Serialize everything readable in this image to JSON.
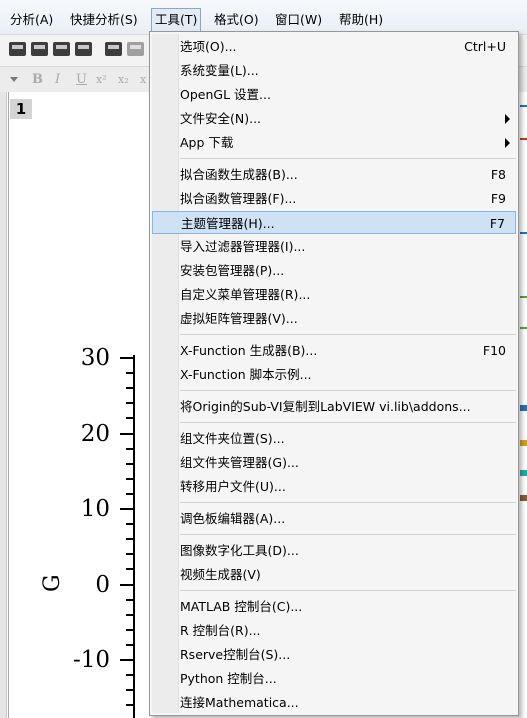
{
  "menubar": {
    "items": [
      {
        "label": "分析(A)"
      },
      {
        "label": "快捷分析(S)"
      },
      {
        "label": "工具(T)",
        "active": true
      },
      {
        "label": "格式(O)"
      },
      {
        "label": "窗口(W)"
      },
      {
        "label": "帮助(H)"
      }
    ]
  },
  "format_toolbar": {
    "buttons": [
      "B",
      "I",
      "U",
      "x²",
      "x₂",
      "x"
    ]
  },
  "graph": {
    "page_number": "1",
    "y_axis": {
      "title": "G",
      "ticks": [
        "30",
        "20",
        "10",
        "0",
        "-10"
      ]
    }
  },
  "tools_menu": {
    "items": [
      {
        "label": "选项(O)...",
        "shortcut": "Ctrl+U"
      },
      {
        "label": "系统变量(L)..."
      },
      {
        "label": "OpenGL 设置..."
      },
      {
        "label": "文件安全(N)...",
        "submenu": true
      },
      {
        "label": "App 下载",
        "submenu": true
      },
      {
        "label": "拟合函数生成器(B)...",
        "shortcut": "F8"
      },
      {
        "label": "拟合函数管理器(F)...",
        "shortcut": "F9"
      },
      {
        "label": "主题管理器(H)...",
        "shortcut": "F7",
        "highlighted": true
      },
      {
        "label": "导入过滤器管理器(I)..."
      },
      {
        "label": "安装包管理器(P)..."
      },
      {
        "label": "自定义菜单管理器(R)..."
      },
      {
        "label": "虚拟矩阵管理器(V)..."
      },
      {
        "label": "X-Function 生成器(B)...",
        "shortcut": "F10"
      },
      {
        "label": "X-Function 脚本示例..."
      },
      {
        "label": "将Origin的Sub-VI复制到LabVIEW vi.lib\\addons..."
      },
      {
        "label": "组文件夹位置(S)..."
      },
      {
        "label": "组文件夹管理器(G)..."
      },
      {
        "label": "转移用户文件(U)..."
      },
      {
        "label": "调色板编辑器(A)..."
      },
      {
        "label": "图像数字化工具(D)..."
      },
      {
        "label": "视频生成器(V)"
      },
      {
        "label": "MATLAB 控制台(C)..."
      },
      {
        "label": "R 控制台(R)..."
      },
      {
        "label": "Rserve控制台(S)..."
      },
      {
        "label": "Python 控制台..."
      },
      {
        "label": "连接Mathematica..."
      }
    ]
  }
}
